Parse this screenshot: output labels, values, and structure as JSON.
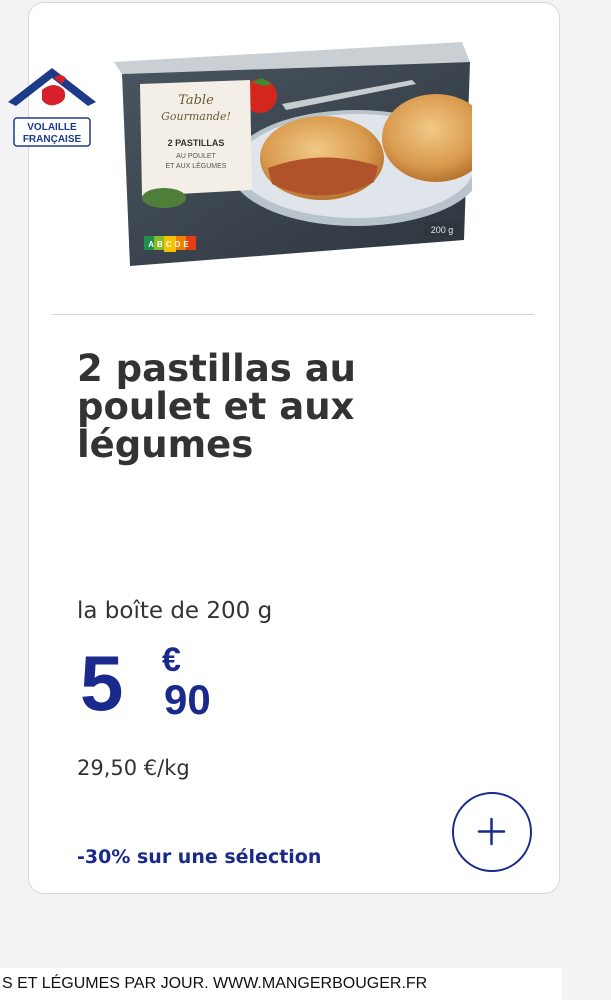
{
  "badge": {
    "line1": "VOLAILLE",
    "line2": "FRANÇAISE"
  },
  "packaging": {
    "brand_line1": "Table",
    "brand_line2": "Gourmande!",
    "product_line1": "2 PASTILLAS",
    "product_line2": "AU POULET",
    "product_line3": "ET AUX LÉGUMES",
    "nutriscore": "ABCDE",
    "weight": "200 g"
  },
  "product": {
    "title": "2 pastillas au poulet et aux légumes",
    "unit": "la boîte de 200 g",
    "price_int": "5",
    "price_currency": "€",
    "price_dec": "90",
    "price_per_kg": "29,50 €/kg",
    "promo": "-30% sur une sélection",
    "add_icon": "plus-icon"
  },
  "footer": {
    "text": "S ET LÉGUMES PAR JOUR. WWW.MANGERBOUGER.FR"
  },
  "colors": {
    "brand_blue": "#1a2a8c",
    "text": "#333333",
    "badge_red": "#d7202c"
  }
}
